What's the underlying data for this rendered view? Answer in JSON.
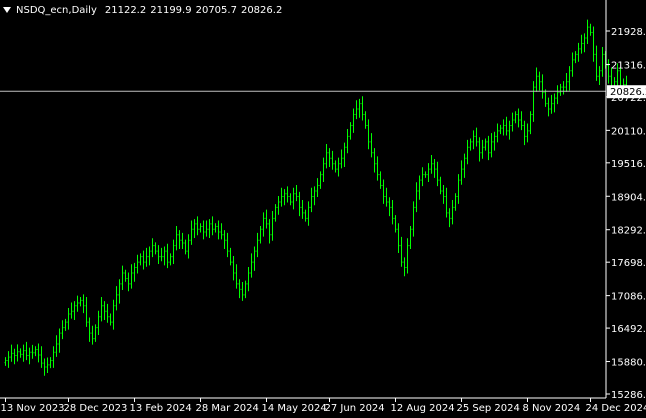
{
  "header": {
    "symbol": "NSDQ_ecn,Daily",
    "open": "21122.2",
    "high": "21199.9",
    "low": "20705.7",
    "close": "20826.2"
  },
  "colors": {
    "background": "#000000",
    "candle": "#00ff00",
    "text": "#ffffff",
    "axis": "#ffffff",
    "price_line": "#c0c0c0",
    "price_label_bg": "#ffffff",
    "price_label_text": "#000000"
  },
  "chart_data": {
    "type": "ohlc",
    "title": "NSDQ_ecn,Daily",
    "current_price": 20826.2,
    "current_price_label": "20826.2",
    "ylim": [
      15286.0,
      22120.0
    ],
    "y_ticks": [
      {
        "value": 21928.0,
        "label": "21928.0"
      },
      {
        "value": 21316.0,
        "label": "21316.0"
      },
      {
        "value": 20722.0,
        "label": "20722.0"
      },
      {
        "value": 20110.0,
        "label": "20110.0"
      },
      {
        "value": 19516.0,
        "label": "19516.0"
      },
      {
        "value": 18904.0,
        "label": "18904.0"
      },
      {
        "value": 18292.0,
        "label": "18292.0"
      },
      {
        "value": 17698.0,
        "label": "17698.0"
      },
      {
        "value": 17086.0,
        "label": "17086.0"
      },
      {
        "value": 16492.0,
        "label": "16492.0"
      },
      {
        "value": 15880.0,
        "label": "15880.0"
      },
      {
        "value": 15286.0,
        "label": "15286.0"
      }
    ],
    "x_ticks": [
      {
        "index": 0,
        "label": "13 Nov 2023"
      },
      {
        "index": 21,
        "label": "28 Dec 2023"
      },
      {
        "index": 43,
        "label": "13 Feb 2024"
      },
      {
        "index": 65,
        "label": "28 Mar 2024"
      },
      {
        "index": 87,
        "label": "14 May 2024"
      },
      {
        "index": 108,
        "label": "27 Jun 2024"
      },
      {
        "index": 130,
        "label": "12 Aug 2024"
      },
      {
        "index": 152,
        "label": "25 Sep 2024"
      },
      {
        "index": 174,
        "label": "8 Nov 2024"
      },
      {
        "index": 195,
        "label": "24 Dec 2024"
      }
    ],
    "closes": [
      15900,
      15960,
      16030,
      15990,
      16060,
      16010,
      16080,
      15990,
      16050,
      16040,
      16100,
      16000,
      15850,
      15780,
      15820,
      15900,
      16050,
      16200,
      16400,
      16500,
      16600,
      16750,
      16800,
      16900,
      16950,
      17000,
      16900,
      16600,
      16400,
      16300,
      16500,
      16700,
      16900,
      16800,
      16700,
      16600,
      16900,
      17100,
      17300,
      17500,
      17400,
      17300,
      17500,
      17600,
      17700,
      17800,
      17700,
      17800,
      17900,
      18000,
      17900,
      17800,
      17800,
      17900,
      17700,
      17800,
      18000,
      18200,
      18100,
      18050,
      17900,
      18100,
      18300,
      18400,
      18300,
      18350,
      18250,
      18300,
      18400,
      18300,
      18350,
      18250,
      18200,
      18100,
      17900,
      17700,
      17500,
      17300,
      17200,
      17100,
      17300,
      17500,
      17700,
      17900,
      18100,
      18300,
      18500,
      18400,
      18200,
      18500,
      18700,
      18800,
      18900,
      18950,
      18900,
      18800,
      18950,
      18900,
      18700,
      18600,
      18500,
      18700,
      18900,
      19000,
      19100,
      19300,
      19500,
      19700,
      19600,
      19500,
      19400,
      19500,
      19600,
      19800,
      20000,
      20200,
      20400,
      20500,
      20600,
      20400,
      20200,
      19900,
      19700,
      19500,
      19300,
      19100,
      18900,
      18800,
      18700,
      18500,
      18300,
      18000,
      17700,
      17600,
      18000,
      18300,
      18700,
      19000,
      19200,
      19300,
      19300,
      19400,
      19500,
      19400,
      19200,
      19000,
      18900,
      18600,
      18500,
      18700,
      18900,
      19200,
      19400,
      19600,
      19800,
      19900,
      20000,
      19900,
      19700,
      19800,
      19900,
      19700,
      19900,
      20000,
      20100,
      20150,
      20200,
      20100,
      20200,
      20300,
      20400,
      20300,
      20200,
      20000,
      20100,
      20400,
      20900,
      21100,
      21000,
      20800,
      20600,
      20500,
      20600,
      20700,
      20800,
      20900,
      20900,
      21000,
      21200,
      21400,
      21500,
      21600,
      21700,
      21800,
      22000,
      21900,
      21500,
      21100,
      21200,
      21500,
      21300,
      21100,
      20900,
      21000,
      21200,
      20900,
      20950,
      20826.2
    ]
  }
}
